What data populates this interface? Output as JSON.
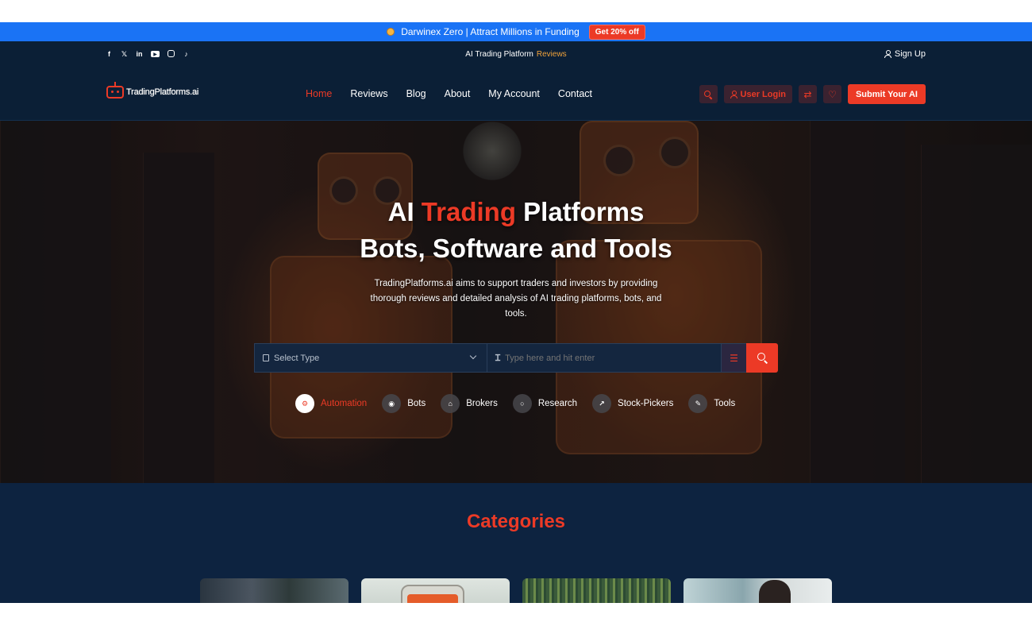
{
  "promo": {
    "text": "Darwinex Zero | Attract Millions in Funding",
    "cta": "Get 20% off"
  },
  "topstrip": {
    "socials": [
      "facebook-icon",
      "x-icon",
      "linkedin-icon",
      "youtube-icon",
      "instagram-icon",
      "tiktok-icon"
    ],
    "center_text": "AI Trading Platform",
    "center_highlight": "Reviews",
    "signup": "Sign Up"
  },
  "header": {
    "logo_text": "TradingPlatforms.ai",
    "nav": [
      "Home",
      "Reviews",
      "Blog",
      "About",
      "My Account",
      "Contact"
    ],
    "active_nav": "Home",
    "login": "User Login",
    "submit": "Submit Your AI"
  },
  "hero": {
    "title_pre": "AI",
    "title_highlight": "Trading",
    "title_post": "Platforms",
    "title_line2": "Bots, Software and Tools",
    "description": "TradingPlatforms.ai aims to support traders and investors by providing thorough reviews and detailed analysis of AI trading platforms, bots, and tools.",
    "select_placeholder": "Select Type",
    "search_placeholder": "Type here and hit enter",
    "chips": [
      {
        "label": "Automation",
        "icon": "gears-icon"
      },
      {
        "label": "Bots",
        "icon": "android-icon"
      },
      {
        "label": "Brokers",
        "icon": "bank-icon"
      },
      {
        "label": "Research",
        "icon": "search-icon"
      },
      {
        "label": "Stock-Pickers",
        "icon": "chart-line-icon"
      },
      {
        "label": "Tools",
        "icon": "wrench-icon"
      }
    ]
  },
  "categories": {
    "title": "Categories"
  },
  "colors": {
    "accent": "#ec3a26",
    "promo_bar": "#1a73f5",
    "navy": "#0b1f36",
    "highlight": "#f0a23a"
  }
}
